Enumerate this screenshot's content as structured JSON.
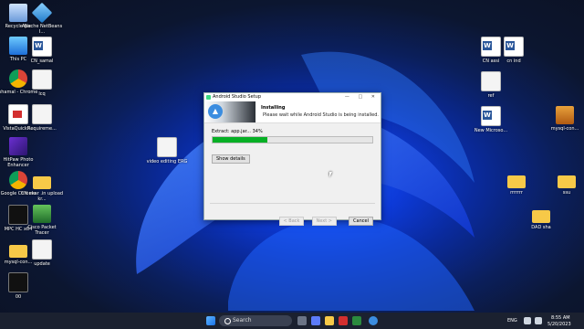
{
  "desktop_icons": [
    {
      "label": "Recycle Bin",
      "icon": "recycle-bin-icon",
      "style": "g-bin"
    },
    {
      "label": "Apache NetBeans I...",
      "icon": "netbeans-icon",
      "style": "g-netbeans"
    },
    {
      "label": "This PC",
      "icon": "this-pc-icon",
      "style": "g-pc"
    },
    {
      "label": "CN_samal",
      "icon": "word-document-icon",
      "style": "g-word"
    },
    {
      "label": "shamal - Chrome",
      "icon": "chrome-icon",
      "style": "g-chrome"
    },
    {
      "label": "lcq",
      "icon": "document-icon",
      "style": "g-doc"
    },
    {
      "label": "VistaQuickF...",
      "icon": "pdf-icon",
      "style": "g-pdf"
    },
    {
      "label": "Requireme...",
      "icon": "document-icon",
      "style": "g-doc"
    },
    {
      "label": "HitPaw Photo Enhancer",
      "icon": "hitpaw-icon",
      "style": "g-purple"
    },
    {
      "label": "video editing ERG",
      "icon": "document-icon",
      "style": "g-doc"
    },
    {
      "label": "Google Chrome",
      "icon": "chrome-icon",
      "style": "g-chrome"
    },
    {
      "label": "CN ekar .in upload kr...",
      "icon": "folder-icon",
      "style": "g-folder"
    },
    {
      "label": "MPC HC x64",
      "icon": "mpc-icon",
      "style": "g-dark"
    },
    {
      "label": "Cisco Packet Tracer",
      "icon": "cisco-icon",
      "style": "g-cisco"
    },
    {
      "label": "mysql-con...",
      "icon": "folder-icon",
      "style": "g-folder"
    },
    {
      "label": "update",
      "icon": "document-icon",
      "style": "g-doc"
    },
    {
      "label": "00",
      "icon": "terminal-icon",
      "style": "g-dark"
    },
    {
      "label": "CN assi",
      "icon": "word-document-icon",
      "style": "g-word"
    },
    {
      "label": "cn ind",
      "icon": "word-document-icon",
      "style": "g-word"
    },
    {
      "label": "ref",
      "icon": "document-icon",
      "style": "g-doc"
    },
    {
      "label": "New Microso...",
      "icon": "word-document-icon",
      "style": "g-word"
    },
    {
      "label": "mysql-con...",
      "icon": "mysql-icon",
      "style": "g-mysql"
    },
    {
      "label": "rrrrrrr",
      "icon": "folder-icon",
      "style": "g-folder"
    },
    {
      "label": "ssu",
      "icon": "folder-icon",
      "style": "g-folder"
    },
    {
      "label": "DAD sha",
      "icon": "folder-icon",
      "style": "g-folder"
    }
  ],
  "setup": {
    "title": "Android Studio Setup",
    "controls": "— □ ✕",
    "heading": "Installing",
    "subheading": "Please wait while Android Studio is being installed.",
    "status": "Extract: app.jar... 34%",
    "progress": 0.34,
    "show_details": "Show details",
    "back": "< Back",
    "next": "Next >",
    "cancel": "Cancel"
  },
  "taskbar": {
    "search_placeholder": "Search",
    "language": "ENG",
    "time": "8:55 AM",
    "date": "5/20/2023"
  }
}
